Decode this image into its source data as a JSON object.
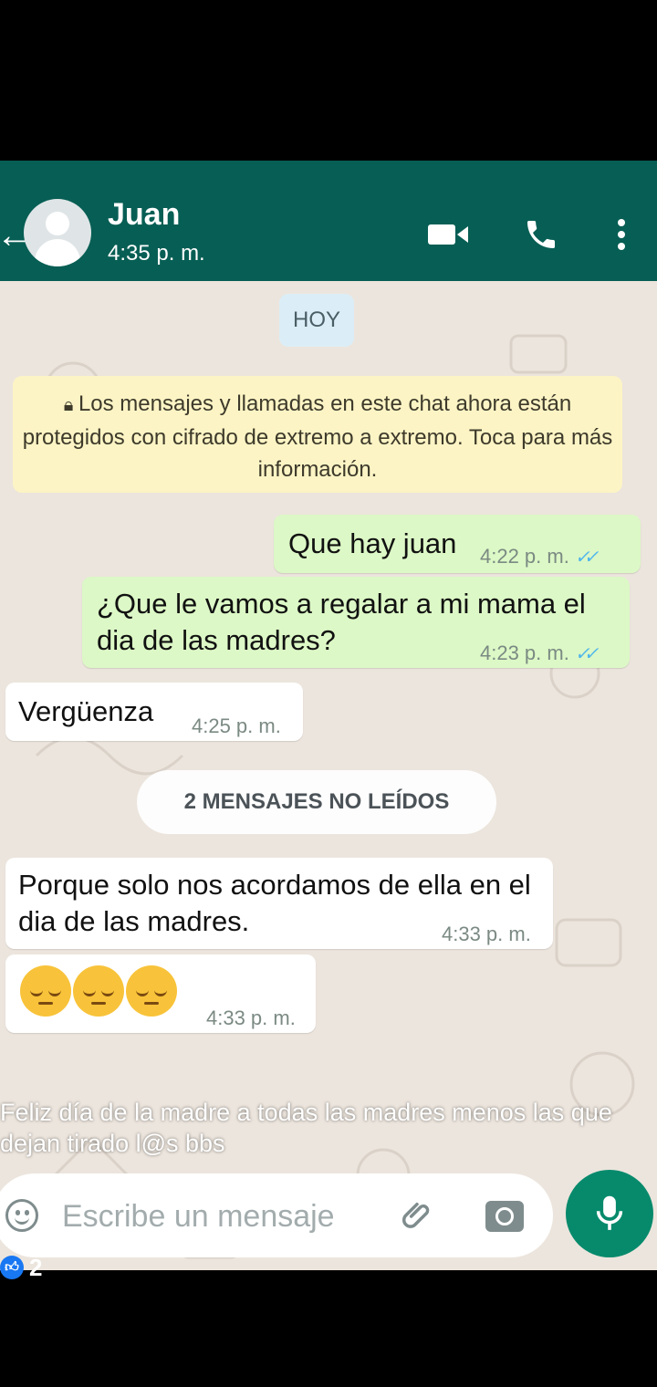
{
  "header": {
    "back_icon": "arrow-left-icon",
    "contact_name": "Juan",
    "last_seen": "4:35 p. m.",
    "icons": [
      "video-call-icon",
      "voice-call-icon",
      "more-options-icon"
    ]
  },
  "chat": {
    "day_label": "HOY",
    "encryption_notice": {
      "lock_icon": "lock-icon",
      "text": "Los mensajes y llamadas en este chat ahora están protegidos con cifrado de extremo a extremo. Toca para más información."
    },
    "messages": [
      {
        "direction": "out",
        "text": "Que hay juan",
        "time": "4:22 p. m.",
        "status_icon": "double-check-icon",
        "status_color": "#4fb6ec"
      },
      {
        "direction": "out",
        "text": "¿Que le vamos a regalar a mi mama el dia de las madres?",
        "time": "4:23 p. m.",
        "status_icon": "double-check-icon",
        "status_color": "#4fb6ec"
      },
      {
        "direction": "in",
        "text": "Vergüenza",
        "time": "4:25 p. m."
      },
      {
        "direction": "in",
        "text": "Porque solo nos acordamos de ella en el dia de las madres.",
        "time": "4:33 p. m."
      },
      {
        "direction": "in",
        "emoji_icons": [
          "pensive-face-icon",
          "pensive-face-icon",
          "pensive-face-icon"
        ],
        "time": "4:33 p. m."
      }
    ],
    "unread_label": "2 MENSAJES NO LEÍDOS"
  },
  "overlay_caption": "Feliz día de la madre a todas las madres menos las que dejan tirado l@s bbs",
  "composer": {
    "emoji_icon": "smiley-icon",
    "placeholder": "Escribe un mensaje",
    "attach_icon": "paperclip-icon",
    "camera_icon": "camera-icon",
    "mic_icon": "microphone-icon"
  },
  "reactions": {
    "like_icon": "thumbs-up-icon",
    "count": "2"
  },
  "colors": {
    "header_bg": "#075e54",
    "outgoing_bubble": "#dcf8c6",
    "incoming_bubble": "#ffffff",
    "chat_bg": "#ece5dd",
    "notice_bg": "#fdf4c5",
    "mic_button": "#078a6c"
  }
}
